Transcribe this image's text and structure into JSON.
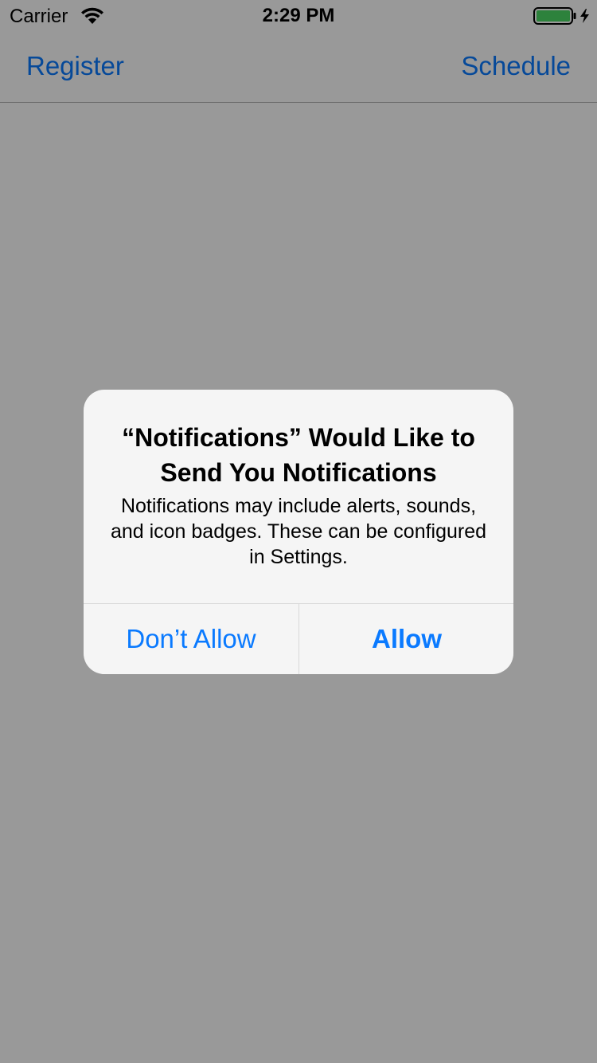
{
  "status_bar": {
    "carrier": "Carrier",
    "time": "2:29 PM",
    "wifi_icon": "wifi-icon",
    "battery_icon": "battery-charging-icon",
    "battery_color": "#4cd964"
  },
  "nav": {
    "left_label": "Register",
    "right_label": "Schedule"
  },
  "alert": {
    "title": "“Notifications” Would Like to Send You Notifications",
    "message": "Notifications may include alerts, sounds, and icon badges. These can be configured in Settings.",
    "deny_label": "Don’t Allow",
    "allow_label": "Allow"
  },
  "colors": {
    "accent": "#0a7aff",
    "overlay": "rgba(0,0,0,0.40)",
    "alert_bg": "#f5f5f5"
  }
}
